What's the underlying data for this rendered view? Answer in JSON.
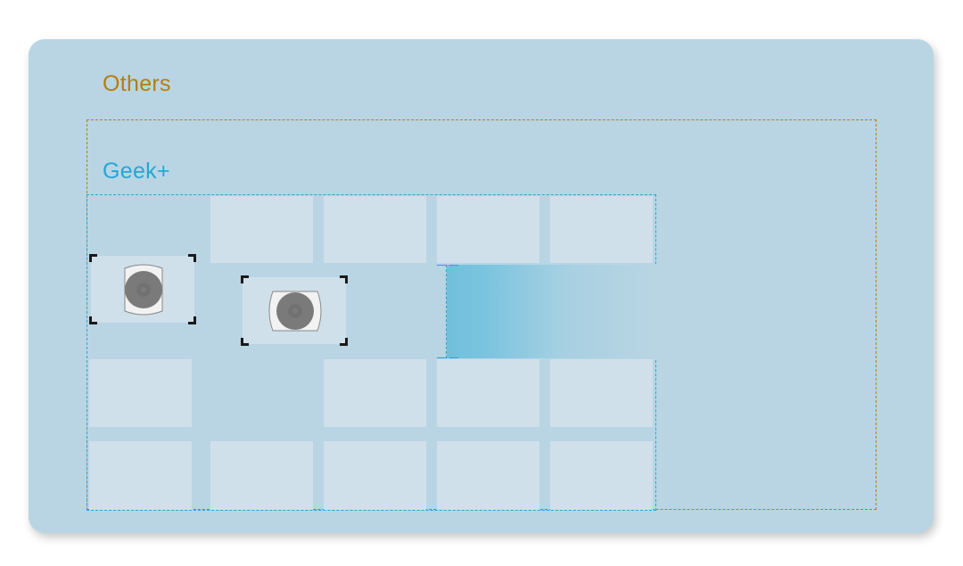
{
  "zones": {
    "others": {
      "label": "Others",
      "color": "#b57d10"
    },
    "geek": {
      "label": "Geek+",
      "color": "#25a6d3"
    }
  },
  "grid": {
    "rows": 4,
    "cols": 5,
    "cell_color": "#cfe0eb",
    "occupied": [
      {
        "row": 0,
        "col": 1
      },
      {
        "row": 0,
        "col": 2
      },
      {
        "row": 0,
        "col": 3
      },
      {
        "row": 0,
        "col": 4
      },
      {
        "row": 2,
        "col": 0
      },
      {
        "row": 2,
        "col": 2
      },
      {
        "row": 2,
        "col": 3
      },
      {
        "row": 2,
        "col": 4
      },
      {
        "row": 3,
        "col": 0
      },
      {
        "row": 3,
        "col": 1
      },
      {
        "row": 3,
        "col": 2
      },
      {
        "row": 3,
        "col": 3
      },
      {
        "row": 3,
        "col": 4
      }
    ]
  },
  "robots": [
    {
      "id": "robot-1",
      "orientation": "vertical"
    },
    {
      "id": "robot-2",
      "orientation": "horizontal"
    }
  ],
  "highlight": {
    "name": "transition-gradient-zone",
    "from_color": "#6fc0dc",
    "to_color": "#b9d5e3"
  },
  "colors": {
    "background_panel": "#b9d5e3",
    "robot_body": "#f2f2f2",
    "robot_disc": "#7a7a7a"
  }
}
